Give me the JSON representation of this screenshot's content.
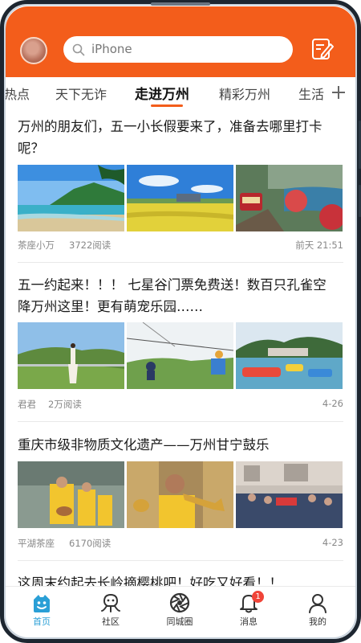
{
  "header": {
    "search_placeholder": "iPhone",
    "brand_color": "#f35d1b"
  },
  "tabs": [
    {
      "label": "热点",
      "active": false
    },
    {
      "label": "天下无诈",
      "active": false
    },
    {
      "label": "走进万州",
      "active": true
    },
    {
      "label": "精彩万州",
      "active": false
    },
    {
      "label": "生活",
      "active": false
    }
  ],
  "articles": [
    {
      "title": "万州的朋友们，五一小长假要来了，准备去哪里打卡呢？",
      "source": "茶座小万",
      "reads": "3722阅读",
      "time": "前天 21:51"
    },
    {
      "title": "五一约起来！！！ 七星谷门票免费送！数百只孔雀空降万州这里！更有萌宠乐园……",
      "source": "君君",
      "reads": "2万阅读",
      "time": "4-26"
    },
    {
      "title": "重庆市级非物质文化遗产——万州甘宁鼓乐",
      "source": "平湖茶座",
      "reads": "6170阅读",
      "time": "4-23"
    },
    {
      "title": "这周末约起去长岭摘樱桃吧！好吃又好看！！"
    }
  ],
  "bottom_nav": [
    {
      "label": "首页",
      "icon": "home-face-icon",
      "active": true
    },
    {
      "label": "社区",
      "icon": "community-icon",
      "active": false
    },
    {
      "label": "同城圈",
      "icon": "aperture-icon",
      "active": false
    },
    {
      "label": "消息",
      "icon": "bell-icon",
      "active": false,
      "badge": "1"
    },
    {
      "label": "我的",
      "icon": "user-icon",
      "active": false
    }
  ],
  "colors": {
    "accent": "#f35d1b",
    "nav_active": "#2a9fd6",
    "badge": "#f04438"
  }
}
